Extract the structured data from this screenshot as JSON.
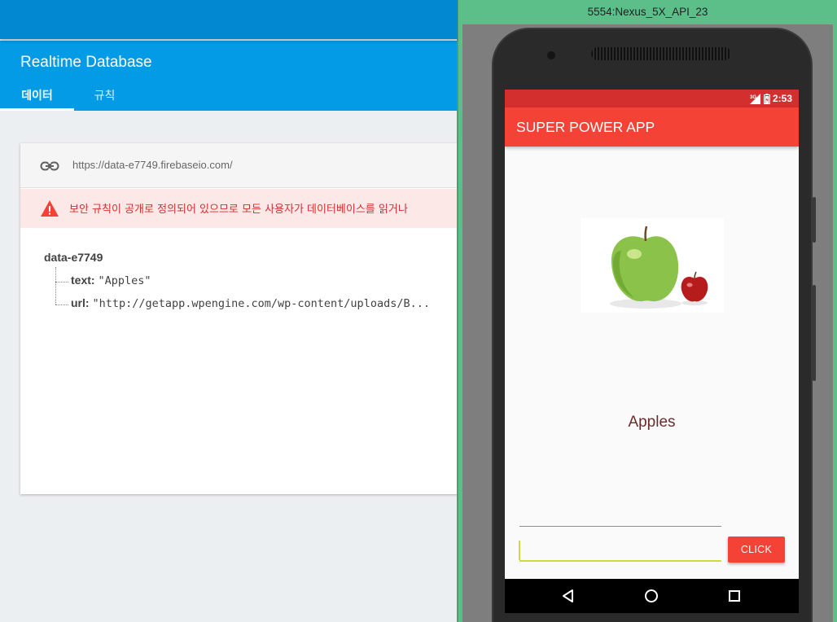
{
  "firebase": {
    "title": "Realtime Database",
    "tabs": [
      {
        "label": "데이터",
        "active": true
      },
      {
        "label": "규칙",
        "active": false
      }
    ],
    "url": "https://data-e7749.firebaseio.com/",
    "warning": "보안 규칙이 공개로 정의되어 있으므로 모든 사용자가 데이터베이스를 읽거나",
    "tree": {
      "root": "data-e7749",
      "children": [
        {
          "key": "text:",
          "value": "\"Apples\""
        },
        {
          "key": "url:",
          "value": "\"http://getapp.wpengine.com/wp-content/uploads/B..."
        }
      ]
    },
    "colors": {
      "header": "#039be5",
      "topbar": "#0288d1",
      "warning_text": "#d32f2f",
      "warning_bg": "#fce8e6"
    }
  },
  "emulator": {
    "title": "5554:Nexus_5X_API_23",
    "status": {
      "network": "3G",
      "time": "2:53"
    },
    "app": {
      "title": "SUPER POWER APP",
      "item_name": "Apples",
      "input_value": "",
      "button_label": "CLICK"
    },
    "nav": [
      "back-icon",
      "home-icon",
      "recents-icon"
    ],
    "colors": {
      "appbar": "#f44336",
      "statusbar": "#d32f2f",
      "accent": "#cddc39"
    }
  }
}
